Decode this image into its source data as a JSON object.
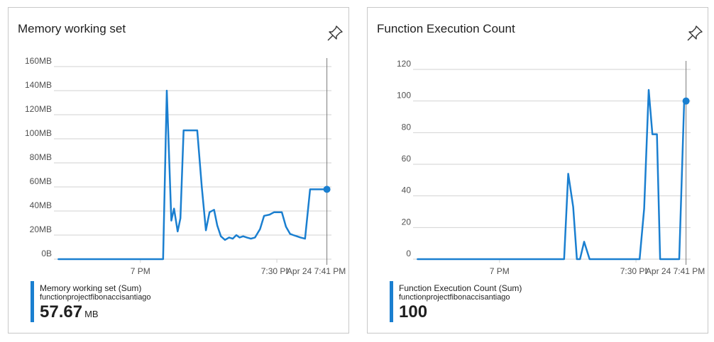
{
  "colors": {
    "series": "#1a7fd0",
    "grid": "#d2d2d2",
    "cursor": "#7a7a7a",
    "border": "#c8c8c8"
  },
  "tiles": [
    {
      "title": "Memory working set",
      "pin_icon": "pin-icon",
      "hover_label": "Apr 24 7:41 PM",
      "legend": {
        "name": "Memory working set (Sum)",
        "resource": "functionprojectfibonaccisantiago",
        "value": "57.67",
        "unit": "MB"
      }
    },
    {
      "title": "Function Execution Count",
      "pin_icon": "pin-icon",
      "hover_label": "Apr 24 7:41 PM",
      "legend": {
        "name": "Function Execution Count (Sum)",
        "resource": "functionprojectfibonaccisantiago",
        "value": "100",
        "unit": ""
      }
    }
  ],
  "chart_data": [
    {
      "type": "line",
      "x_tick_labels": [
        "7 PM",
        "7:30 PM"
      ],
      "x_ticks_minutes": [
        0,
        30
      ],
      "xlim_minutes": [
        -19,
        42
      ],
      "y_tick_labels": [
        "0B",
        "20MB",
        "40MB",
        "60MB",
        "80MB",
        "100MB",
        "120MB",
        "140MB",
        "160MB"
      ],
      "ylim": [
        0,
        160
      ],
      "y_unit": "MB",
      "grid": true,
      "hover_x_minutes": 41,
      "series": [
        {
          "name": "Memory working set (Sum)",
          "x": [
            -18,
            5,
            5.8,
            6.8,
            7.4,
            8.2,
            8.8,
            9.5,
            10.5,
            12.5,
            13.5,
            14.4,
            15.2,
            16.2,
            16.9,
            17.7,
            18.6,
            19.5,
            20.3,
            21.1,
            21.8,
            22.6,
            23.4,
            24.3,
            25.2,
            26.3,
            27.2,
            28.4,
            29.4,
            30.3,
            31.1,
            32,
            32.9,
            33.6,
            34.4,
            35.2,
            36.2,
            37.3,
            38.1,
            38.7,
            39.8,
            40.8,
            41.2
          ],
          "values": [
            0,
            0,
            140,
            32,
            42,
            23,
            34,
            107,
            107,
            107,
            60,
            24,
            39,
            41,
            28,
            19,
            16,
            18,
            17,
            20,
            18,
            19,
            18,
            17,
            18,
            25,
            36,
            37,
            39,
            39,
            39,
            27,
            21,
            20,
            19,
            18,
            17,
            58,
            58,
            58,
            58,
            58,
            58
          ]
        }
      ]
    },
    {
      "type": "line",
      "x_tick_labels": [
        "7 PM",
        "7:30 PM"
      ],
      "x_ticks_minutes": [
        0,
        30
      ],
      "xlim_minutes": [
        -19,
        42
      ],
      "y_tick_labels": [
        "0",
        "20",
        "40",
        "60",
        "80",
        "100",
        "120"
      ],
      "ylim": [
        0,
        120
      ],
      "grid": true,
      "hover_x_minutes": 41,
      "series": [
        {
          "name": "Function Execution Count (Sum)",
          "x": [
            -18,
            14.2,
            15.1,
            16.2,
            17,
            17.7,
            18.6,
            19.8,
            30.8,
            31.8,
            32.8,
            33.6,
            34.6,
            35.3,
            36.1,
            38.3,
            39.5,
            40.6,
            41.2
          ],
          "values": [
            0,
            0,
            54,
            33,
            0,
            0,
            11,
            0,
            0,
            32,
            107,
            79,
            79,
            0,
            0,
            0,
            0,
            100,
            100
          ]
        }
      ]
    }
  ]
}
